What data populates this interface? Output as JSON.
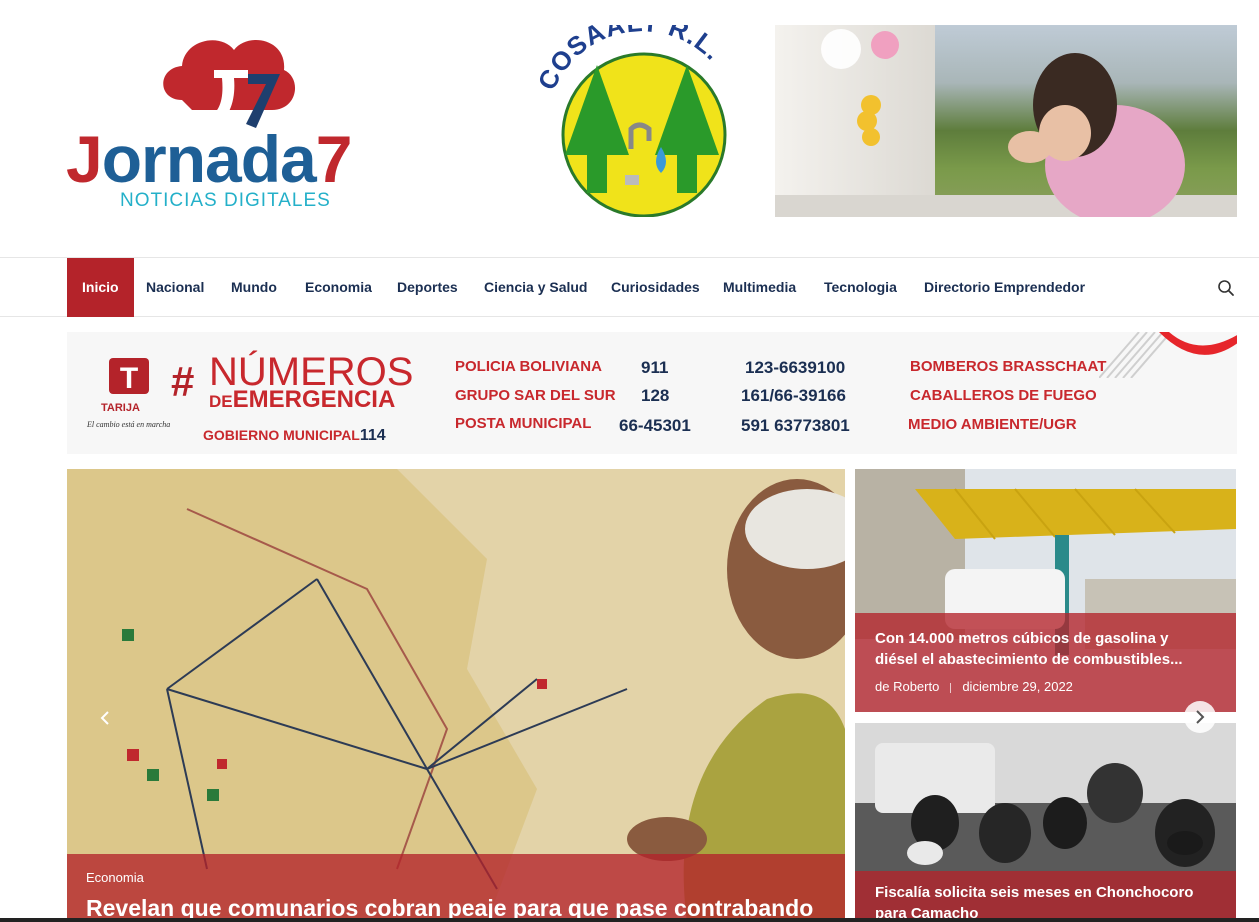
{
  "site": {
    "logo_word_j": "J",
    "logo_word_rest": "ornada",
    "logo_word_seven": "7",
    "logo_tagline": "NOTICIAS DIGITALES"
  },
  "ad_top": {
    "brand": "COSAALT R.L."
  },
  "nav": {
    "items": [
      {
        "label": "Inicio",
        "active": true
      },
      {
        "label": "Nacional"
      },
      {
        "label": "Mundo"
      },
      {
        "label": "Economia"
      },
      {
        "label": "Deportes"
      },
      {
        "label": "Ciencia y Salud"
      },
      {
        "label": "Curiosidades"
      },
      {
        "label": "Multimedia"
      },
      {
        "label": "Tecnologia"
      },
      {
        "label": "Directorio Emprendedor"
      }
    ],
    "search_icon": "search-icon"
  },
  "ad_emergency": {
    "tarija": "TARIJA",
    "motto": "El cambio está en marcha",
    "hash": "#",
    "title_1": "NÚMEROS",
    "title_2_de": "DE",
    "title_2_rest": "EMERGENCIA",
    "gobierno": "GOBIERNO MUNICIPAL",
    "gobierno_num": "114",
    "rows": [
      {
        "name": "POLICIA BOLIVIANA",
        "num": "911",
        "num2": "123-6639100",
        "name2": "BOMBEROS BRASSCHAAT"
      },
      {
        "name": "GRUPO SAR DEL SUR",
        "num": "128",
        "num2": "161/66-39166",
        "name2": "CABALLEROS DE  FUEGO"
      },
      {
        "name": "POSTA MUNICIPAL",
        "num": "66-45301",
        "num2": "591 63773801",
        "name2": "MEDIO AMBIENTE/UGR"
      }
    ]
  },
  "main_story": {
    "category": "Economia",
    "title": "Revelan que comunarios cobran peaje para que pase contrabando"
  },
  "side_stories": [
    {
      "title": "Con 14.000 metros cúbicos de gasolina y diésel el abastecimiento de combustibles...",
      "author": "de Roberto",
      "date": "diciembre 29, 2022"
    },
    {
      "title": "Fiscalía solicita seis meses en Chonchocoro para Camacho"
    }
  ],
  "colors": {
    "accent": "#b4232a",
    "nav_text": "#1b2f52",
    "logo_blue": "#1e5f96",
    "logo_cyan": "#24b0c9"
  }
}
